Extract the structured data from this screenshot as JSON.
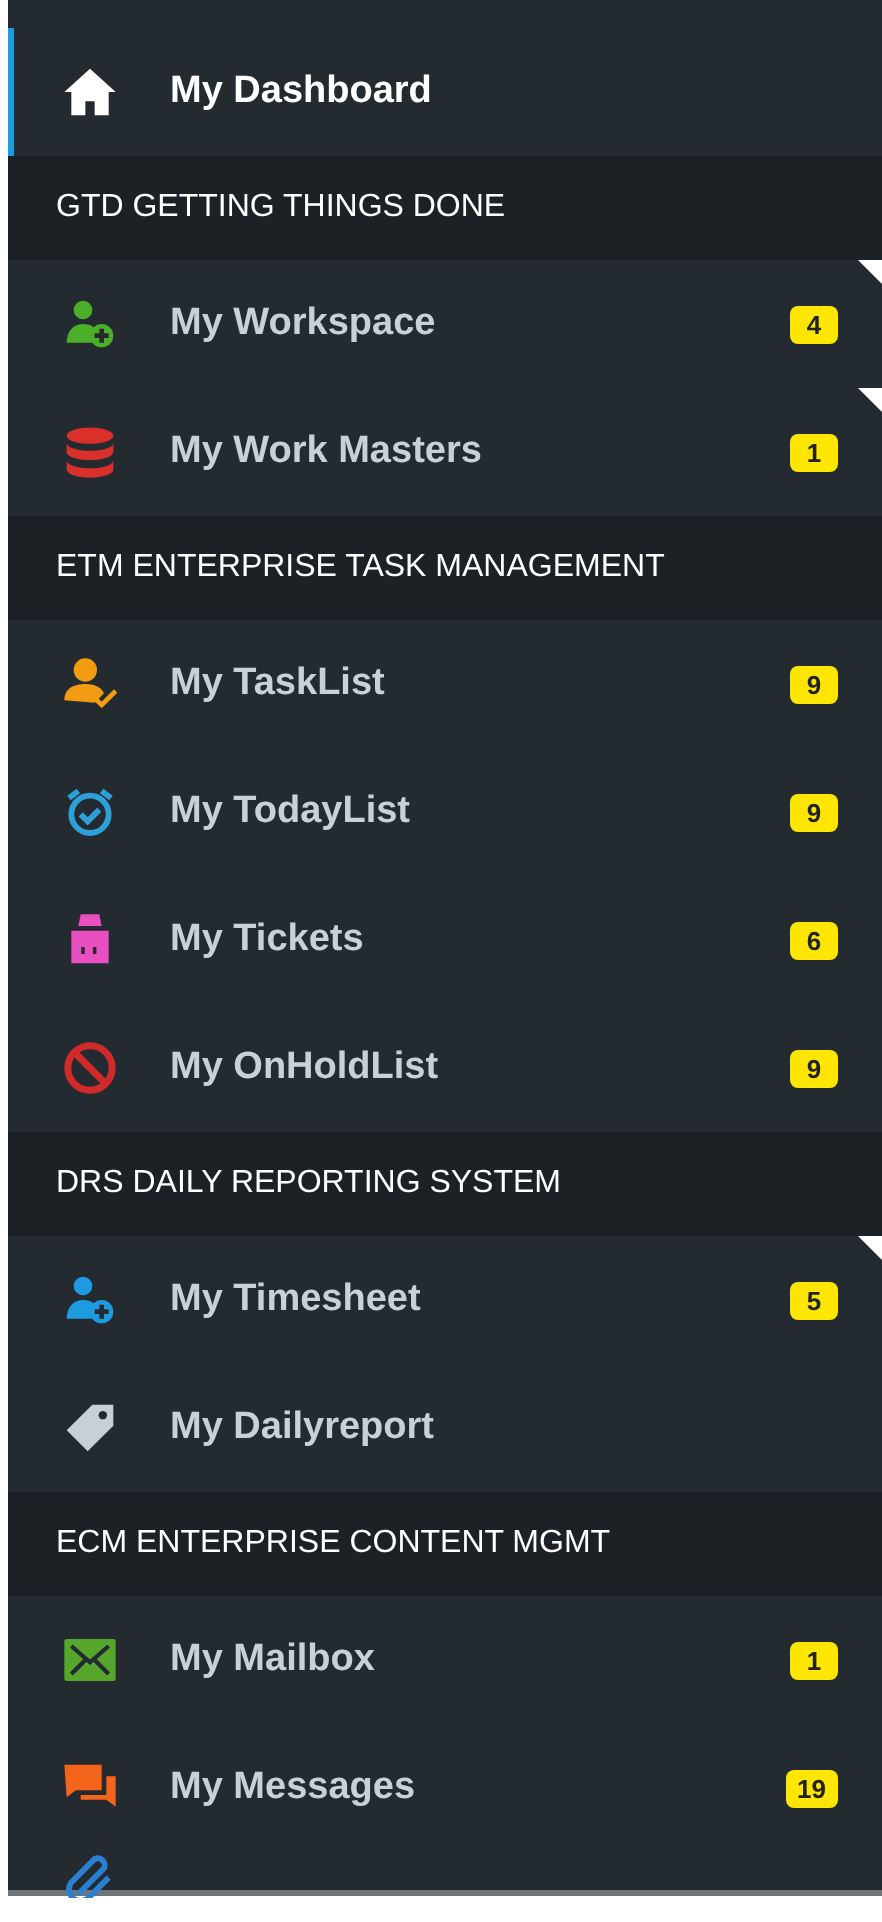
{
  "dashboard": {
    "label": "My Dashboard",
    "selected": true
  },
  "sections": [
    {
      "title": "GTD GETTING THINGS DONE",
      "items": [
        {
          "label": "My Workspace",
          "badge": "4",
          "submenu": true
        },
        {
          "label": "My Work Masters",
          "badge": "1",
          "submenu": true
        }
      ]
    },
    {
      "title": "ETM ENTERPRISE TASK MANAGEMENT",
      "items": [
        {
          "label": "My TaskList",
          "badge": "9",
          "submenu": false
        },
        {
          "label": "My TodayList",
          "badge": "9",
          "submenu": false
        },
        {
          "label": "My Tickets",
          "badge": "6",
          "submenu": false
        },
        {
          "label": "My OnHoldList",
          "badge": "9",
          "submenu": false
        }
      ]
    },
    {
      "title": "DRS DAILY REPORTING SYSTEM",
      "items": [
        {
          "label": "My Timesheet",
          "badge": "5",
          "submenu": true
        },
        {
          "label": "My Dailyreport",
          "submenu": false
        }
      ]
    },
    {
      "title": "ECM ENTERPRISE CONTENT MGMT",
      "items": [
        {
          "label": "My Mailbox",
          "badge": "1",
          "submenu": false
        },
        {
          "label": "My Messages",
          "badge": "19",
          "submenu": false
        }
      ]
    }
  ]
}
